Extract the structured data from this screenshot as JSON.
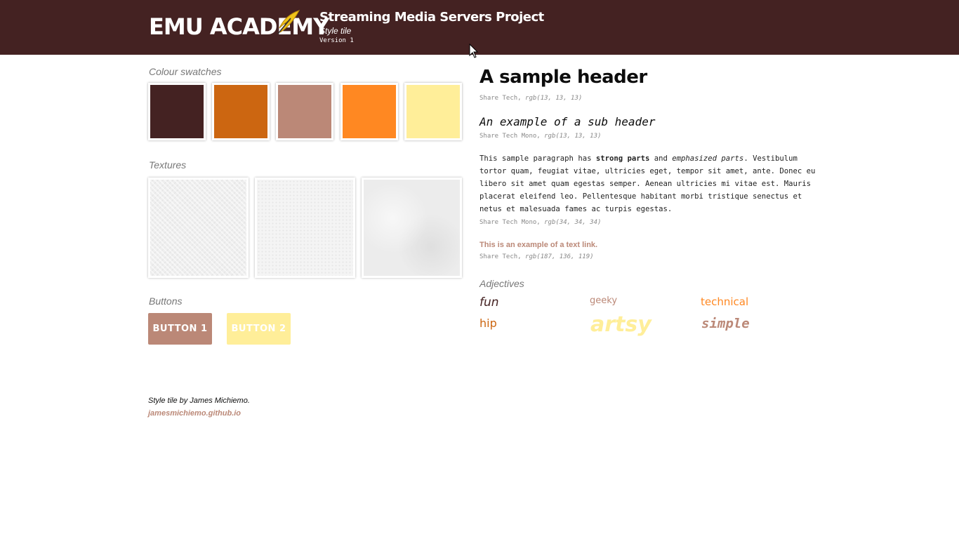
{
  "header": {
    "logo": "EMU ACADEMY",
    "project_title": "Streaming Media Servers Project",
    "subtitle": "Style tile",
    "version": "Version 1"
  },
  "left": {
    "swatches_label": "Colour swatches",
    "swatches": [
      "#442222",
      "#cc6611",
      "#bb8877",
      "#ff8822",
      "#ffee99"
    ],
    "textures_label": "Textures",
    "buttons_label": "Buttons",
    "button1": "BUTTON 1",
    "button2": "BUTTON 2"
  },
  "right": {
    "header": "A sample header",
    "header_font": "Share Tech,",
    "header_color": "rgb(13, 13, 13)",
    "subheader": "An example of a sub header",
    "subheader_font": "Share Tech Mono,",
    "subheader_color": "rgb(13, 13, 13)",
    "paragraph": {
      "p1": "This sample paragraph has ",
      "strong": "strong parts",
      "p2": " and ",
      "em": "emphasized parts",
      "p3": ". Vestibulum tortor quam, feugiat vitae, ultricies eget, tempor sit amet, ante. Donec eu libero sit amet quam egestas semper. Aenean ultricies mi vitae est. Mauris placerat eleifend leo. Pellentesque habitant morbi tristique senectus et netus et malesuada fames ac turpis egestas."
    },
    "paragraph_font": "Share Tech Mono,",
    "paragraph_color": "rgb(34, 34, 34)",
    "link": "This is an example of a text link.",
    "link_font": "Share Tech,",
    "link_color": "rgb(187, 136, 119)",
    "adjectives_label": "Adjectives",
    "adjectives": [
      "fun",
      "geeky",
      "technical",
      "hip",
      "artsy",
      "simple"
    ]
  },
  "footer": {
    "credit": "Style tile by James Michiemo.",
    "link": "jamesmichiemo.github.io"
  }
}
